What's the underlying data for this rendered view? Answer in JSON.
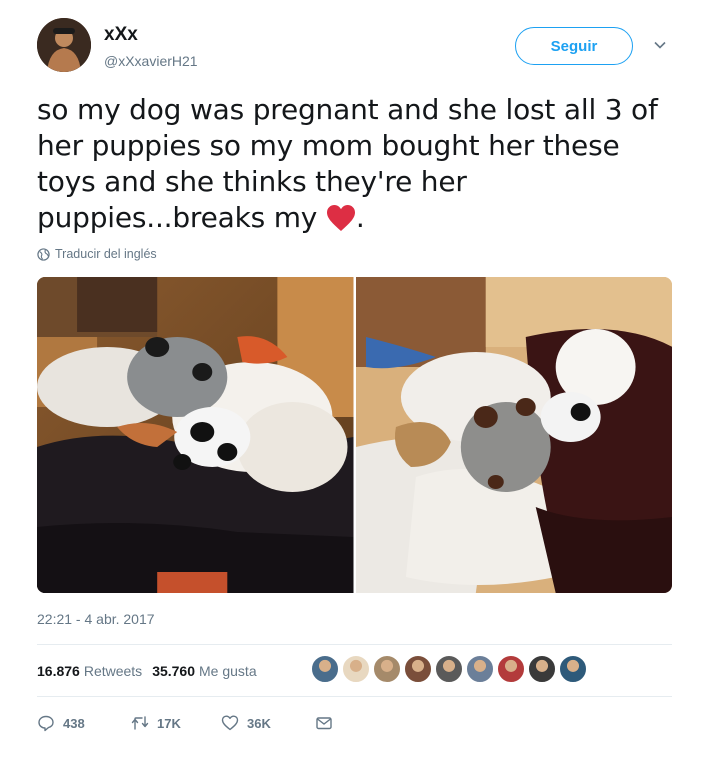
{
  "user": {
    "display_name": "xXx",
    "handle": "@xXxavierH21"
  },
  "follow_button": {
    "label": "Seguir"
  },
  "tweet": {
    "line1": "so my dog was pregnant and she lost all 3 of",
    "line2": "her puppies so my mom bought her these",
    "line3": "toys and she thinks they're her",
    "line4_before": "puppies...breaks my",
    "line4_after": ".",
    "emoji": "red-heart-icon"
  },
  "translate": {
    "label": "Traducir del inglés"
  },
  "timestamp": "22:21 - 4 abr. 2017",
  "stats": {
    "retweets_count": "16.876",
    "retweets_label": "Retweets",
    "likes_count": "35.760",
    "likes_label": "Me gusta"
  },
  "liker_colors": [
    "#4a6d8c",
    "#e8d8c0",
    "#a58a6a",
    "#7a4e3a",
    "#5a5a5a",
    "#6b7f99",
    "#b33b3b",
    "#3a3a3a",
    "#2e5a7a"
  ],
  "actions": {
    "replies": "438",
    "retweets": "17K",
    "likes": "36K"
  },
  "colors": {
    "accent": "#1da1f2",
    "heart": "#e0245e",
    "muted": "#657786"
  }
}
